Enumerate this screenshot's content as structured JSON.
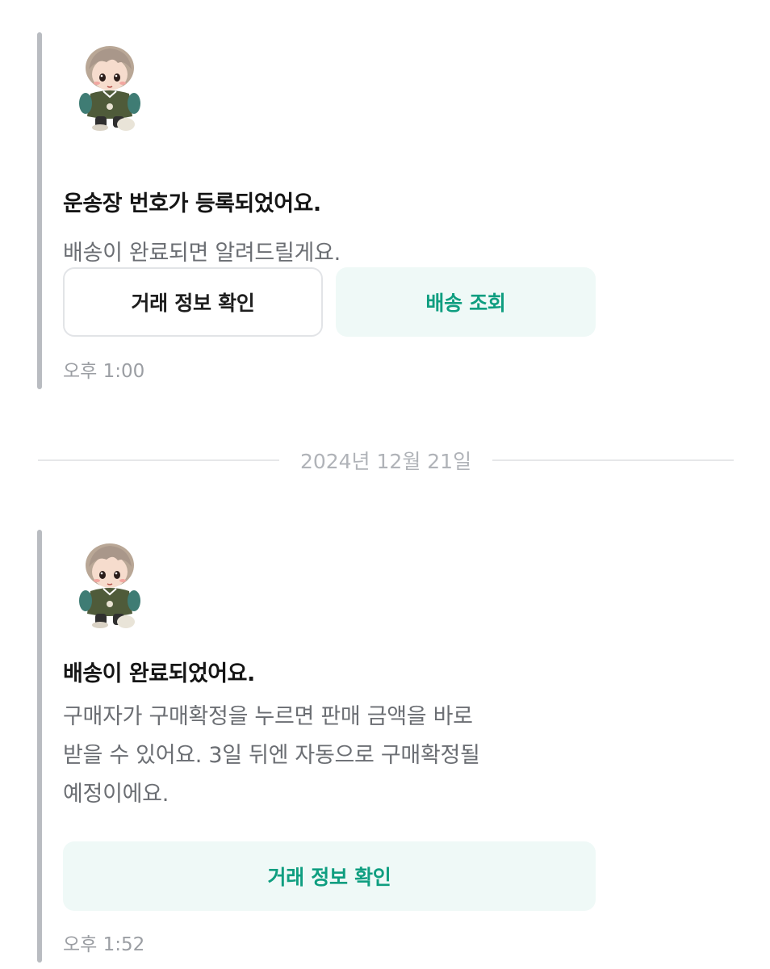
{
  "messages": [
    {
      "title": "운송장 번호가 등록되었어요.",
      "description": "배송이 완료되면 알려드릴게요.",
      "buttons": {
        "trade_info": "거래 정보 확인",
        "track_delivery": "배송 조회"
      },
      "time": "오후 1:00"
    },
    {
      "title": "배송이 완료되었어요.",
      "description_lines": [
        "구매자가 구매확정을 누르면 판매 금액을 바로",
        "받을 수 있어요. 3일 뒤엔 자동으로 구매확정될",
        "예정이에요."
      ],
      "buttons": {
        "trade_info": "거래 정보 확인"
      },
      "time": "오후 1:52"
    }
  ],
  "date_divider": "2024년 12월 21일",
  "avatar_icon": "plush-doll-avatar",
  "colors": {
    "accent_text": "#0f9e80",
    "accent_bg": "#eff9f7",
    "bar": "#b9bcc1"
  }
}
